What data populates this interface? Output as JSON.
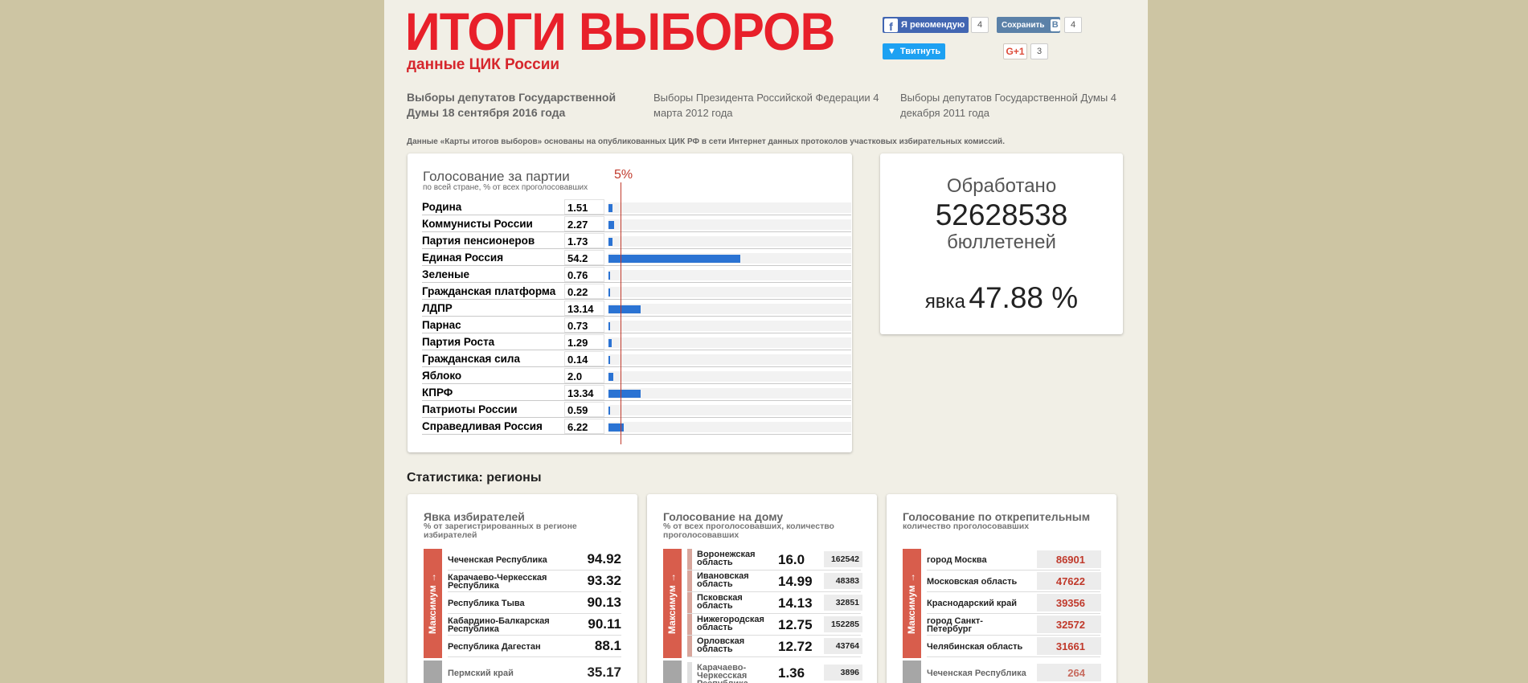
{
  "header": {
    "title": "ИТОГИ ВЫБОРОВ",
    "subtitle": "данные ЦИК России"
  },
  "social": {
    "fb_label": "Я рекомендую",
    "fb_count": "4",
    "vk_label": "Сохранить",
    "vk_count": "4",
    "twitter_label": "Твитнуть",
    "gplus_label": "G+1",
    "gplus_count": "3"
  },
  "elections": [
    {
      "label": "Выборы депутатов Государственной Думы 18 сентября 2016 года"
    },
    {
      "label": "Выборы Президента Российской Федерации 4 марта 2012 года"
    },
    {
      "label": "Выборы депутатов Государственной Думы 4 декабря 2011 года"
    }
  ],
  "note": "Данные «Карты итогов выборов» основаны на опубликованных ЦИК РФ в сети Интернет данных протоколов участковых избирательных комиссий.",
  "party_chart": {
    "title": "Голосование за партии",
    "subtitle": "по всей стране, % от всех проголосовавших",
    "threshold_label": "5%"
  },
  "chart_data": {
    "type": "bar",
    "title": "Голосование за партии",
    "subtitle": "по всей стране, % от всех проголосовавших",
    "categories": [
      "Родина",
      "Коммунисты России",
      "Партия пенсионеров",
      "Единая Россия",
      "Зеленые",
      "Гражданская платформа",
      "ЛДПР",
      "Парнас",
      "Партия Роста",
      "Гражданская сила",
      "Яблоко",
      "КПРФ",
      "Патриоты России",
      "Справедливая Россия"
    ],
    "values": [
      1.51,
      2.27,
      1.73,
      54.2,
      0.76,
      0.22,
      13.14,
      0.73,
      1.29,
      0.14,
      2.0,
      13.34,
      0.59,
      6.22
    ],
    "value_labels": [
      "1.51",
      "2.27",
      "1.73",
      "54.2",
      "0.76",
      "0.22",
      "13.14",
      "0.73",
      "1.29",
      "0.14",
      "2.0",
      "13.34",
      "0.59",
      "6.22"
    ],
    "xlim": [
      0,
      100
    ],
    "threshold": 5,
    "bar_color": "#2b73d3",
    "threshold_color": "#c0392b"
  },
  "processed": {
    "label_top": "Обработано",
    "count": "52628538",
    "label_bottom": "бюллетеней",
    "turnout_word": "явка",
    "turnout_value": "47.88 %"
  },
  "stats_heading": "Статистика: регионы",
  "regions": {
    "max_label": "Максимум →",
    "turnout": {
      "title": "Явка избирателей",
      "subtitle": "% от зарегистрированных в регионе избирателей",
      "max_rows": [
        {
          "name": "Чеченская Республика",
          "value": "94.92"
        },
        {
          "name": "Карачаево-Черкесская Республика",
          "value": "93.32"
        },
        {
          "name": "Республика Тыва",
          "value": "90.13"
        },
        {
          "name": "Кабардино-Балкарская Республика",
          "value": "90.11"
        },
        {
          "name": "Республика Дагестан",
          "value": "88.1"
        }
      ],
      "min_rows": [
        {
          "name": "Пермский край",
          "value": "35.17"
        }
      ]
    },
    "home": {
      "title": "Голосование на дому",
      "subtitle": "% от всех проголосовавших, количество проголосовавших",
      "max_rows": [
        {
          "name": "Воронежская область",
          "value": "16.0",
          "count": "162542"
        },
        {
          "name": "Ивановская область",
          "value": "14.99",
          "count": "48383"
        },
        {
          "name": "Псковская область",
          "value": "14.13",
          "count": "32851"
        },
        {
          "name": "Нижегородская область",
          "value": "12.75",
          "count": "152285"
        },
        {
          "name": "Орловская область",
          "value": "12.72",
          "count": "43764"
        }
      ],
      "min_rows": [
        {
          "name": "Карачаево-Черкесская Республика",
          "value": "1.36",
          "count": "3896"
        }
      ]
    },
    "absentee": {
      "title": "Голосование по открепительным",
      "subtitle": "количество проголосовавших",
      "max_rows": [
        {
          "name": "город Москва",
          "count": "86901"
        },
        {
          "name": "Московская область",
          "count": "47622"
        },
        {
          "name": "Краснодарский край",
          "count": "39356"
        },
        {
          "name": "город Санкт-Петербург",
          "count": "32572"
        },
        {
          "name": "Челябинская область",
          "count": "31661"
        }
      ],
      "min_rows": [
        {
          "name": "Чеченская Республика",
          "count": "264"
        }
      ]
    }
  }
}
